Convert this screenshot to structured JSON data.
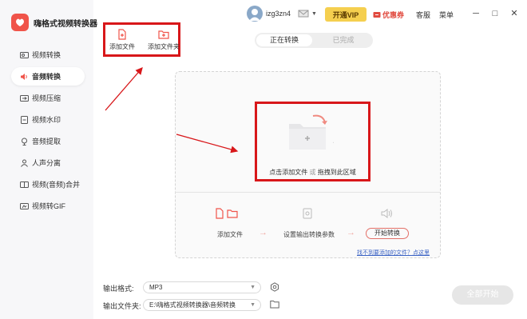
{
  "app": {
    "title": "嗨格式视频转换器"
  },
  "sidebar": {
    "items": [
      {
        "label": "视频转换",
        "icon": "video-convert-icon"
      },
      {
        "label": "音频转换",
        "icon": "audio-convert-icon",
        "active": true
      },
      {
        "label": "视频压缩",
        "icon": "video-compress-icon"
      },
      {
        "label": "视频水印",
        "icon": "video-watermark-icon"
      },
      {
        "label": "音频提取",
        "icon": "audio-extract-icon"
      },
      {
        "label": "人声分离",
        "icon": "vocal-separate-icon"
      },
      {
        "label": "视频(音频)合并",
        "icon": "merge-icon"
      },
      {
        "label": "视频转GIF",
        "icon": "gif-icon"
      }
    ]
  },
  "topbar": {
    "username": "izg3zn4",
    "vip_label": "开通VIP",
    "coupon_label": "优惠券",
    "service_label": "客服",
    "menu_label": "菜单",
    "minimize": "─",
    "maximize": "□",
    "close": "✕"
  },
  "toolbar": {
    "add_file": "添加文件",
    "add_folder": "添加文件夹"
  },
  "tabs": {
    "converting": "正在转换",
    "completed": "已完成"
  },
  "drop": {
    "hint_click": "点击添加文件",
    "hint_or": "或",
    "hint_drag": "拖拽到此区域"
  },
  "steps": {
    "add_file": "添加文件",
    "settings": "设置输出转换参数",
    "start": "开始转换",
    "arrow": "→",
    "help": "找不到要添加的文件？点这里"
  },
  "bottom": {
    "format_label": "输出格式:",
    "format_value": "MP3",
    "folder_label": "输出文件夹:",
    "folder_value": "E:\\嗨格式视频转换器\\音频转换",
    "start_all": "全部开始"
  },
  "colors": {
    "accent": "#f0544a",
    "highlight": "#d8171a",
    "vip": "#f5cf4f"
  }
}
